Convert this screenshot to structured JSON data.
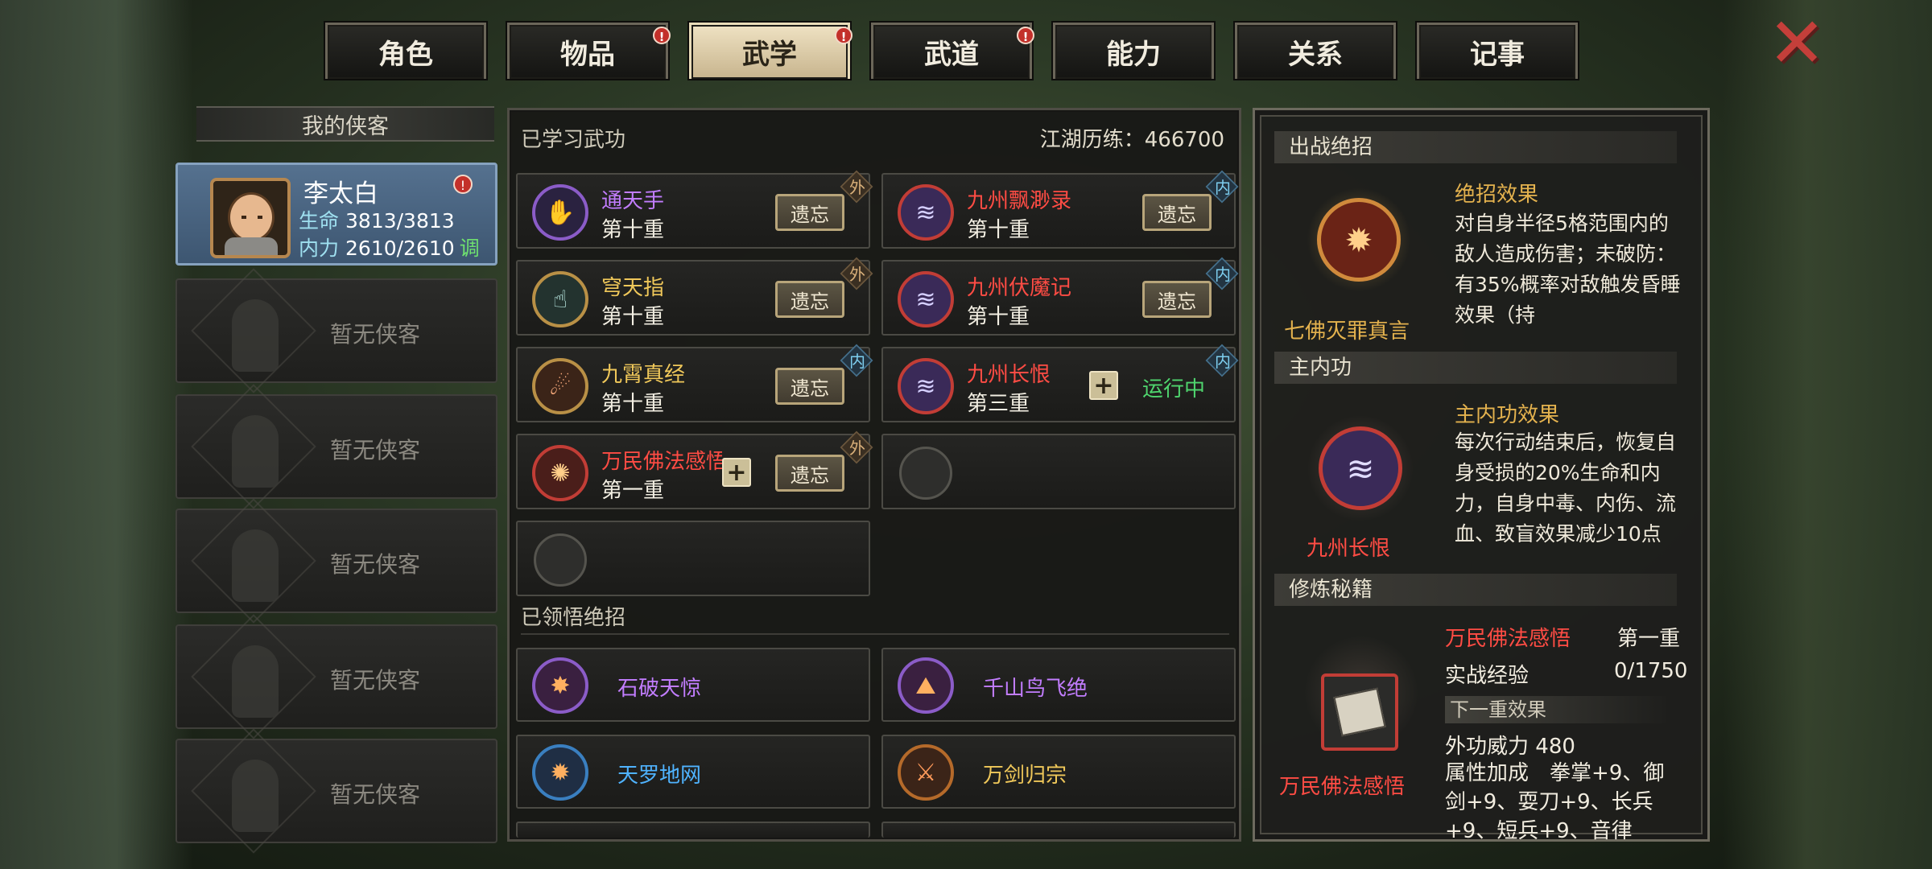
{
  "tabs": [
    {
      "label": "角色",
      "alert": false
    },
    {
      "label": "物品",
      "alert": true
    },
    {
      "label": "武学",
      "alert": true,
      "active": true
    },
    {
      "label": "武道",
      "alert": true
    },
    {
      "label": "能力",
      "alert": false
    },
    {
      "label": "关系",
      "alert": false
    },
    {
      "label": "记事",
      "alert": false
    }
  ],
  "alert_mark": "!",
  "close_glyph": "✕",
  "roster": {
    "title": "我的侠客",
    "selected": {
      "name": "李太白",
      "hp_label": "生命",
      "hp": "3813/3813",
      "mp_label": "内力",
      "mp": "2610/2610",
      "tune": "调"
    },
    "empty_label": "暂无侠客",
    "empty_count": 5
  },
  "learned": {
    "title": "已学习武功",
    "experience": "江湖历练：466700",
    "forget_label": "遗忘",
    "running_label": "运行中",
    "tag_outer": "外",
    "tag_inner": "内",
    "plus": "+",
    "skills": [
      {
        "name": "通天手",
        "level": "第十重",
        "color": "#c27dff",
        "tag": "外",
        "icon": "hand-icon",
        "glyph": "✋",
        "ring": "#8b5cc8"
      },
      {
        "name": "九州飘渺录",
        "level": "第十重",
        "color": "#ff4c44",
        "tag": "内",
        "icon": "waterfall-icon",
        "glyph": "≋",
        "ring": "#c23d36"
      },
      {
        "name": "穹天指",
        "level": "第十重",
        "color": "#f0c85a",
        "tag": "外",
        "icon": "finger-icon",
        "glyph": "☝",
        "ring": "#b99046"
      },
      {
        "name": "九州伏魔记",
        "level": "第十重",
        "color": "#ff4c44",
        "tag": "内",
        "icon": "waterfall-icon",
        "glyph": "≋",
        "ring": "#c23d36"
      },
      {
        "name": "九霄真经",
        "level": "第十重",
        "color": "#f0c85a",
        "tag": "内",
        "icon": "swirl-icon",
        "glyph": "☄",
        "ring": "#b99046"
      },
      {
        "name": "九州长恨",
        "level": "第三重",
        "color": "#ff4c44",
        "tag": "内",
        "icon": "waterfall-icon",
        "glyph": "≋",
        "ring": "#c23d36",
        "running": true
      },
      {
        "name": "万民佛法感悟",
        "level": "第一重",
        "color": "#ff4c44",
        "tag": "外",
        "icon": "lotus-icon",
        "glyph": "✺",
        "ring": "#c23d36"
      }
    ]
  },
  "insights": {
    "title": "已领悟绝招",
    "items": [
      {
        "name": "石破天惊",
        "color": "#c27dff",
        "icon": "burst-icon",
        "glyph": "✸",
        "ring": "#8b5cc8"
      },
      {
        "name": "千山鸟飞绝",
        "color": "#c27dff",
        "icon": "mountain-icon",
        "glyph": "⛰",
        "ring": "#8b5cc8"
      },
      {
        "name": "天罗地网",
        "color": "#4fb3ff",
        "icon": "net-icon",
        "glyph": "✹",
        "ring": "#3a7fc0"
      },
      {
        "name": "万剑归宗",
        "color": "#f0c85a",
        "icon": "swords-icon",
        "glyph": "⚔",
        "ring": "#b56a2a"
      }
    ]
  },
  "detail": {
    "ultimate_section": "出战绝招",
    "ultimate_name": "七佛灭罪真言",
    "ultimate_effect_label": "绝招效果",
    "ultimate_effect": "对自身半径5格范围内的敌人造成伤害；未破防：有35%概率对敌触发昏睡效果（持",
    "main_section": "主内功",
    "main_name": "九州长恨",
    "main_effect_label": "主内功效果",
    "main_effect": "每次行动结束后，恢复自身受损的20%生命和内力，自身中毒、内伤、流血、致盲效果减少10点",
    "cultivate_section": "修炼秘籍",
    "book_name": "万民佛法感悟",
    "book_level": "第一重",
    "exp_label": "实战经验",
    "exp_value": "0/1750",
    "next_label": "下一重效果",
    "power_label": "外功威力",
    "power_value": "480",
    "attr_label": "属性加成",
    "attr_value": "拳掌+9、御剑+9、耍刀+9、长兵+9、短兵+9、音律"
  },
  "colors": {
    "red": "#ff4c44",
    "gold": "#f0c85a",
    "purple": "#c27dff",
    "blue": "#4fb3ff",
    "green": "#4fd56e"
  }
}
